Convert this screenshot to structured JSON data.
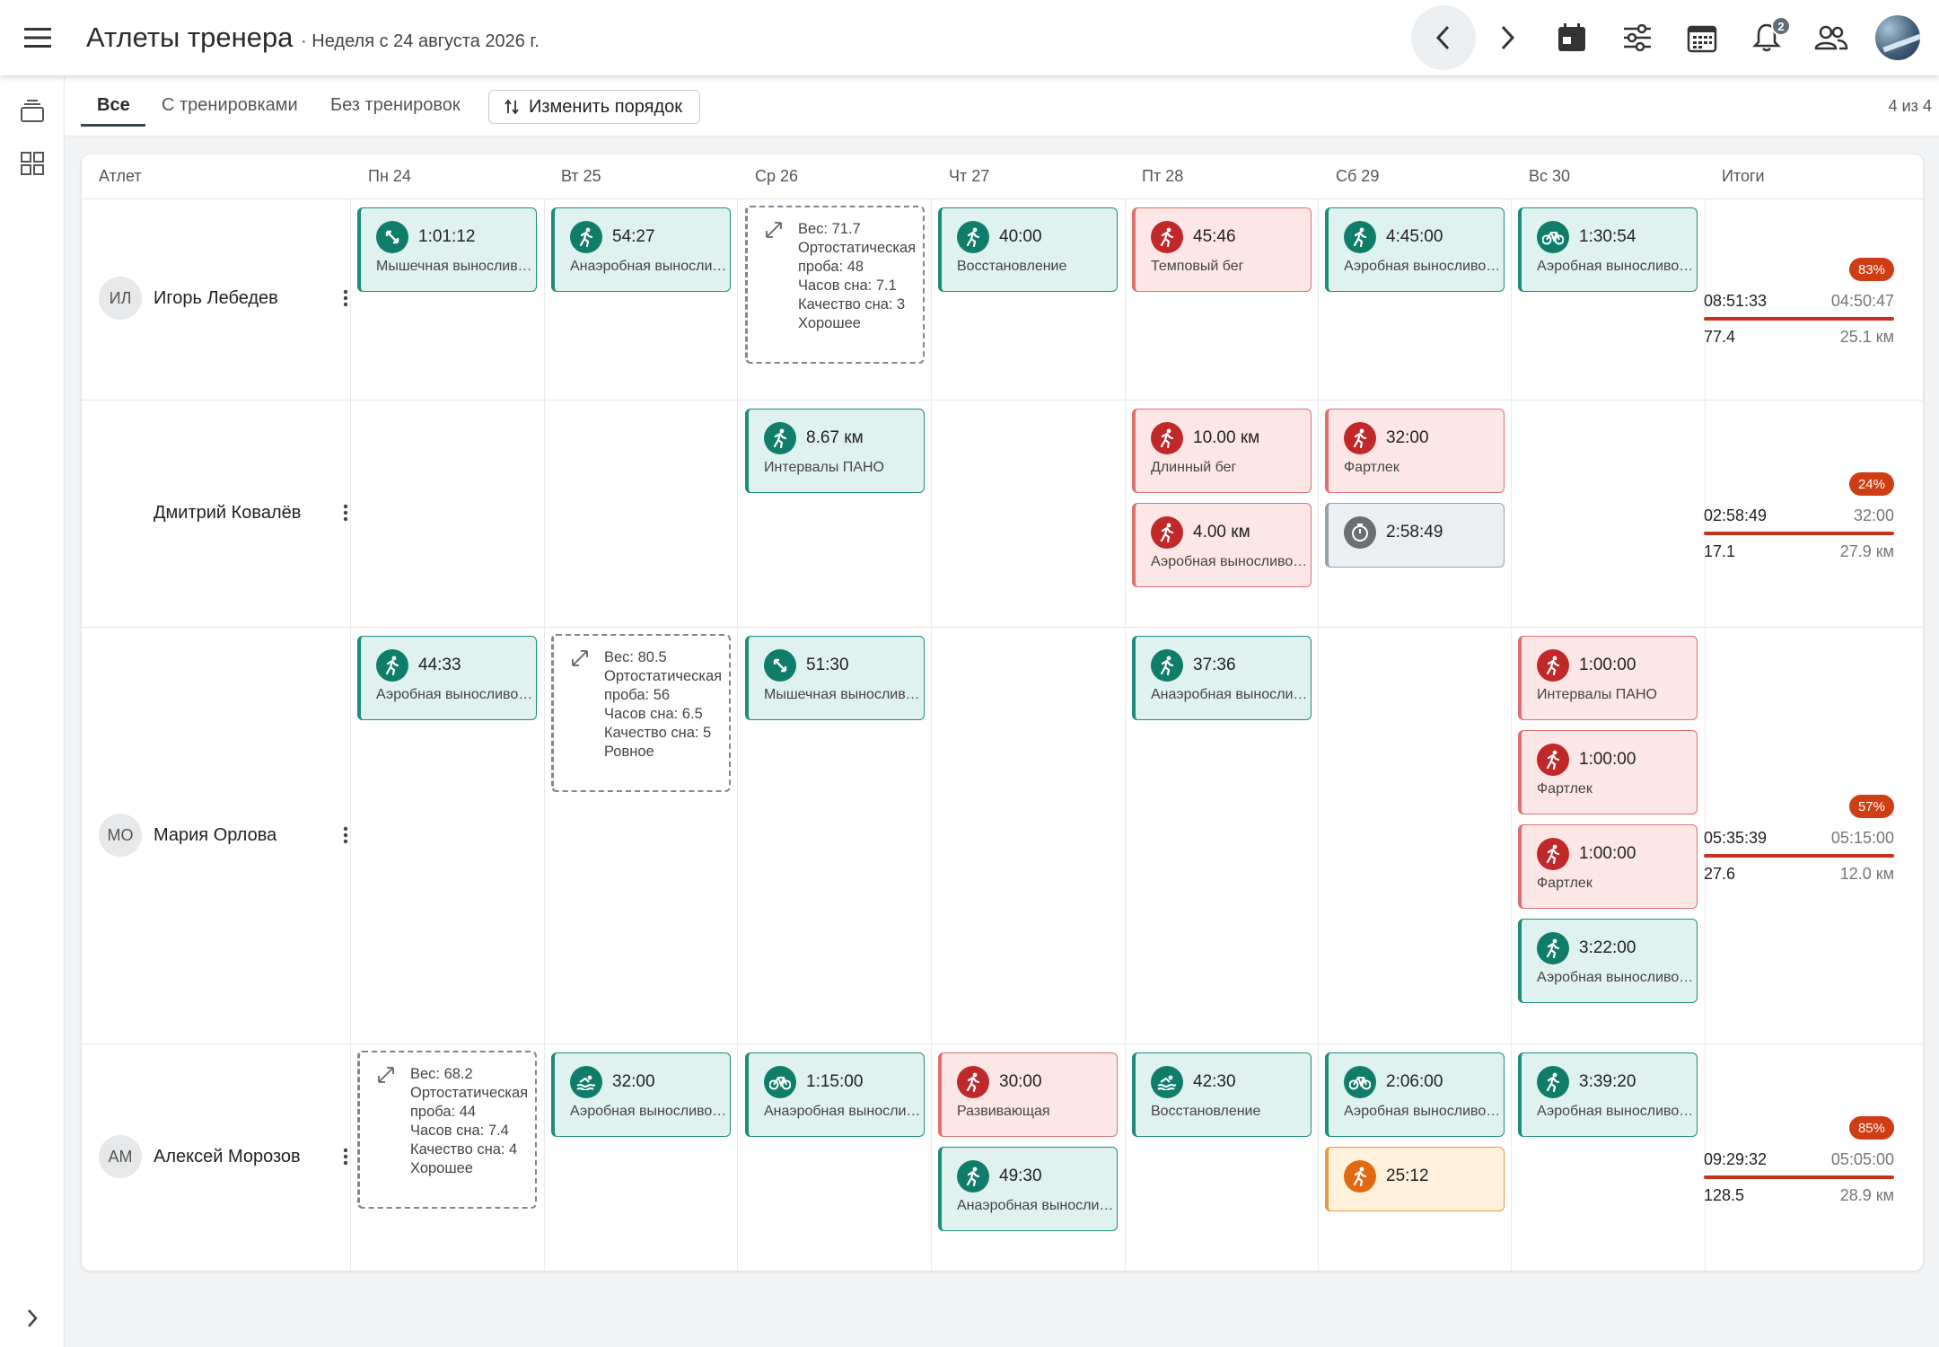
{
  "header": {
    "title": "Атлеты тренера",
    "subtitle": "· Неделя с 24 августа 2026 г.",
    "notifications": "2"
  },
  "tabs": {
    "all": "Все",
    "with": "С тренировками",
    "without": "Без тренировок",
    "reorder": "Изменить порядок",
    "count": "4 из 4"
  },
  "columns": {
    "athlete": "Атлет",
    "d1": "Пн 24",
    "d2": "Вт 25",
    "d3": "Ср 26",
    "d4": "Чт 27",
    "d5": "Пт 28",
    "d6": "Сб 29",
    "d7": "Вс 30",
    "totals": "Итоги"
  },
  "colors": {
    "aerobic": "#0f7d6a",
    "intense": "#c0282a",
    "medium": "#e06a12",
    "neutral": "#6b6f73"
  },
  "athletes": [
    {
      "initials": "ИЛ",
      "name": "Игорь Лебедев",
      "cards": [
        {
          "time": "1:01:12",
          "label": "Мышечная выносливость",
          "icon": "strength-icon"
        },
        {
          "time": "54:27",
          "label": "Анаэробная выносливость",
          "icon": "run-icon"
        },
        {
          "time": "40:00",
          "label": "Восстановление",
          "icon": "run-icon"
        },
        {
          "time": "45:46",
          "label": "Темповый бег",
          "icon": "run-icon"
        },
        {
          "time": "4:45:00",
          "label": "Аэробная выносливость",
          "icon": "run-icon"
        },
        {
          "time": "1:30:54",
          "label": "Аэробная выносливость",
          "icon": "bike-icon"
        }
      ],
      "note": "Вес: 71.7\nОртостатическая проба: 48\nЧасов сна: 7.1\nКачество сна: 3\nХорошее",
      "totals": {
        "percent": "83%",
        "time_actual": "08:51:33",
        "time_plan": "04:50:47",
        "dist_actual": "77.4",
        "dist_plan": "25.1 км"
      }
    },
    {
      "initials": "",
      "name": "Дмитрий Ковалёв",
      "cards": [
        {
          "time": "8.67 км",
          "label": "Интервалы ПАНО",
          "icon": "run-icon"
        },
        {
          "time": "10.00 км",
          "label": "Длинный бег",
          "icon": "run-icon"
        },
        {
          "time": "4.00 км",
          "label": "Аэробная выносливость",
          "icon": "run-icon"
        },
        {
          "time": "32:00",
          "label": "Фартлек",
          "icon": "run-icon"
        },
        {
          "time": "2:58:49",
          "label": "",
          "icon": "stopwatch-icon"
        }
      ],
      "totals": {
        "percent": "24%",
        "time_actual": "02:58:49",
        "time_plan": "32:00",
        "dist_actual": "17.1",
        "dist_plan": "27.9 км"
      }
    },
    {
      "initials": "МО",
      "name": "Мария Орлова",
      "cards": [
        {
          "time": "44:33",
          "label": "Аэробная выносливость",
          "icon": "run-icon"
        },
        {
          "time": "51:30",
          "label": "Мышечная выносливость",
          "icon": "strength-icon"
        },
        {
          "time": "37:36",
          "label": "Анаэробная выносливость",
          "icon": "run-icon"
        },
        {
          "time": "1:00:00",
          "label": "Интервалы ПАНО",
          "icon": "run-icon"
        },
        {
          "time": "1:00:00",
          "label": "Фартлек",
          "icon": "run-icon"
        },
        {
          "time": "1:00:00",
          "label": "Фартлек",
          "icon": "run-icon"
        },
        {
          "time": "3:22:00",
          "label": "Аэробная выносливость",
          "icon": "run-icon"
        }
      ],
      "note": "Вес: 80.5\nОртостатическая проба: 56\nЧасов сна: 6.5\nКачество сна: 5\nРовное",
      "totals": {
        "percent": "57%",
        "time_actual": "05:35:39",
        "time_plan": "05:15:00",
        "dist_actual": "27.6",
        "dist_plan": "12.0 км"
      }
    },
    {
      "initials": "АМ",
      "name": "Алексей Морозов",
      "cards": [
        {
          "time": "32:00",
          "label": "Аэробная выносливость",
          "icon": "swim-icon"
        },
        {
          "time": "1:15:00",
          "label": "Анаэробная выносливость",
          "icon": "bike-icon"
        },
        {
          "time": "30:00",
          "label": "Развивающая",
          "icon": "run-icon"
        },
        {
          "time": "49:30",
          "label": "Анаэробная выносливость",
          "icon": "run-icon"
        },
        {
          "time": "42:30",
          "label": "Восстановление",
          "icon": "swim-icon"
        },
        {
          "time": "2:06:00",
          "label": "Аэробная выносливость",
          "icon": "bike-icon"
        },
        {
          "time": "25:12",
          "label": "",
          "icon": "run-icon"
        },
        {
          "time": "3:39:20",
          "label": "Аэробная выносливость",
          "icon": "run-icon"
        }
      ],
      "note": "Вес: 68.2\nОртостатическая проба: 44\nЧасов сна: 7.4\nКачество сна: 4\nХорошее",
      "totals": {
        "percent": "85%",
        "time_actual": "09:29:32",
        "time_plan": "05:05:00",
        "dist_actual": "128.5",
        "dist_plan": "28.9 км"
      }
    }
  ]
}
